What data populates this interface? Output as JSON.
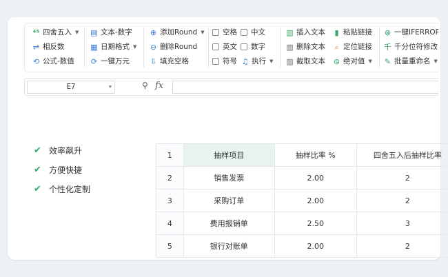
{
  "ribbon": {
    "col1": [
      {
        "label": "四舍五入",
        "icon": "round-icon",
        "caret": true
      },
      {
        "label": "相反数",
        "icon": "swap-icon",
        "caret": false
      },
      {
        "label": "公式-数值",
        "icon": "formula-icon",
        "caret": false
      }
    ],
    "col2": [
      {
        "label": "文本-数字",
        "icon": "text-number-icon",
        "caret": false
      },
      {
        "label": "日期格式",
        "icon": "calendar-icon",
        "caret": true
      },
      {
        "label": "一键万元",
        "icon": "wan-icon",
        "caret": false
      }
    ],
    "col3": [
      {
        "label": "添加Round",
        "icon": "add-round-icon",
        "caret": true
      },
      {
        "label": "删除Round",
        "icon": "delete-round-icon",
        "caret": false
      },
      {
        "label": "填充空格",
        "icon": "fill-blank-icon",
        "caret": false
      }
    ],
    "col4a": [
      "空格",
      "英文",
      "符号"
    ],
    "col4b": [
      "中文",
      "数字"
    ],
    "exec": {
      "label": "执行",
      "icon": "bell-icon"
    },
    "col5": [
      {
        "label": "插入文本",
        "icon": "insert-text-icon"
      },
      {
        "label": "删除文本",
        "icon": "delete-text-icon"
      },
      {
        "label": "截取文本",
        "icon": "cut-text-icon"
      }
    ],
    "col6": [
      {
        "label": "粘贴链接",
        "icon": "paste-link-icon",
        "caret": false
      },
      {
        "label": "定位链接",
        "icon": "locate-link-icon",
        "caret": false
      },
      {
        "label": "绝对值",
        "icon": "abs-icon",
        "caret": true
      }
    ],
    "col7": [
      {
        "label": "一键IFERROR",
        "icon": "iferror-icon",
        "caret": false
      },
      {
        "label": "千分位符修改",
        "icon": "thousand-icon",
        "caret": false
      },
      {
        "label": "批量重命名",
        "icon": "rename-icon",
        "caret": true
      }
    ]
  },
  "formula_bar": {
    "cell_ref": "E7",
    "fx": "fx",
    "value": ""
  },
  "features": [
    "效率飙升",
    "方便快捷",
    "个性化定制"
  ],
  "table": {
    "row_numbers": [
      "1",
      "2",
      "3",
      "4",
      "5"
    ],
    "headers": [
      "抽样项目",
      "抽样比率 %",
      "四舍五入后抽样比率"
    ],
    "rows": [
      [
        "销售发票",
        "2.00",
        "2"
      ],
      [
        "采购订单",
        "2.00",
        "2"
      ],
      [
        "费用报销单",
        "2.50",
        "3"
      ],
      [
        "银行对账单",
        "2.00",
        "2"
      ]
    ]
  },
  "colors": {
    "accent": "#35a76a",
    "header_bg": "#e7f3ec",
    "page_bg": "#eef1f4"
  }
}
